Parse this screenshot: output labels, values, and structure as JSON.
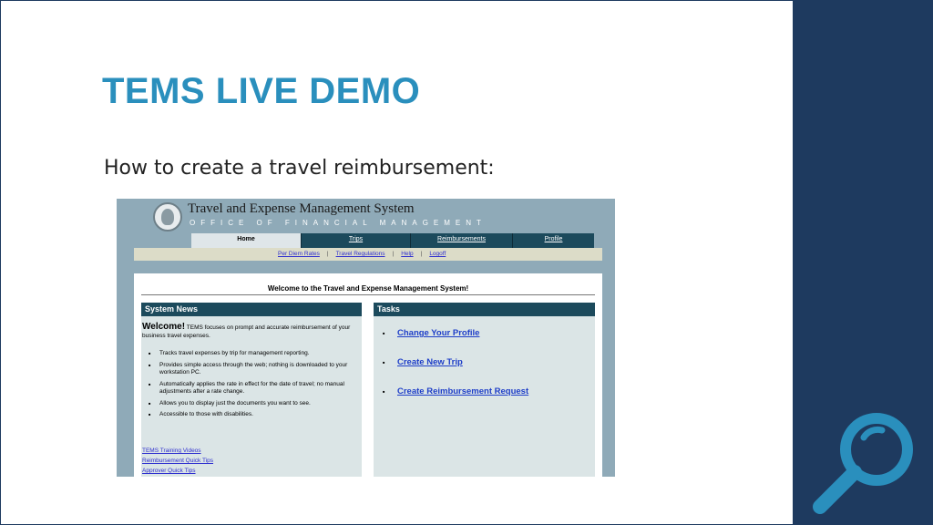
{
  "slide": {
    "title": "TEMS LIVE DEMO",
    "subtitle": "How to create a travel reimbursement:"
  },
  "screenshot": {
    "system_title": "Travel and Expense Management System",
    "system_subtitle": "OFFICE OF FINANCIAL MANAGEMENT",
    "tabs": [
      {
        "label": "Home",
        "active": true
      },
      {
        "label": "Trips",
        "active": false
      },
      {
        "label": "Reimbursements",
        "active": false
      },
      {
        "label": "Profile",
        "active": false
      }
    ],
    "subnav": [
      "Per Diem Rates",
      "Travel Regulations",
      "Help",
      "Logoff"
    ],
    "welcome_heading": "Welcome to the Travel and Expense Management System!",
    "system_news": {
      "heading": "System News",
      "welcome_word": "Welcome!",
      "welcome_text": "TEMS focuses on prompt and accurate reimbursement of your business travel expenses.",
      "bullets": [
        "Tracks travel expenses by trip for management reporting.",
        "Provides simple access through the web; nothing is downloaded to your workstation PC.",
        "Automatically applies the rate in effect for the date of travel; no manual adjustments after a rate change.",
        "Allows you to display just the documents you want to see.",
        "Accessible to those with disabilities."
      ],
      "links": [
        "TEMS Training Videos",
        "Reimbursement Quick Tips",
        "Approver Quick Tips"
      ]
    },
    "tasks": {
      "heading": "Tasks",
      "items": [
        "Change Your Profile",
        "Create New Trip",
        "Create Reimbursement Request"
      ]
    }
  },
  "colors": {
    "title": "#2a8fbd",
    "sidebar": "#1e3a5f",
    "header_band": "#8faab8",
    "panel_head": "#1c4a5c",
    "panel_body": "#dbe5e6",
    "link": "#1e3ec8",
    "magnifier": "#2a8fbd"
  },
  "icons": {
    "magnifier": "magnifying-glass-icon",
    "seal": "state-seal-icon"
  }
}
